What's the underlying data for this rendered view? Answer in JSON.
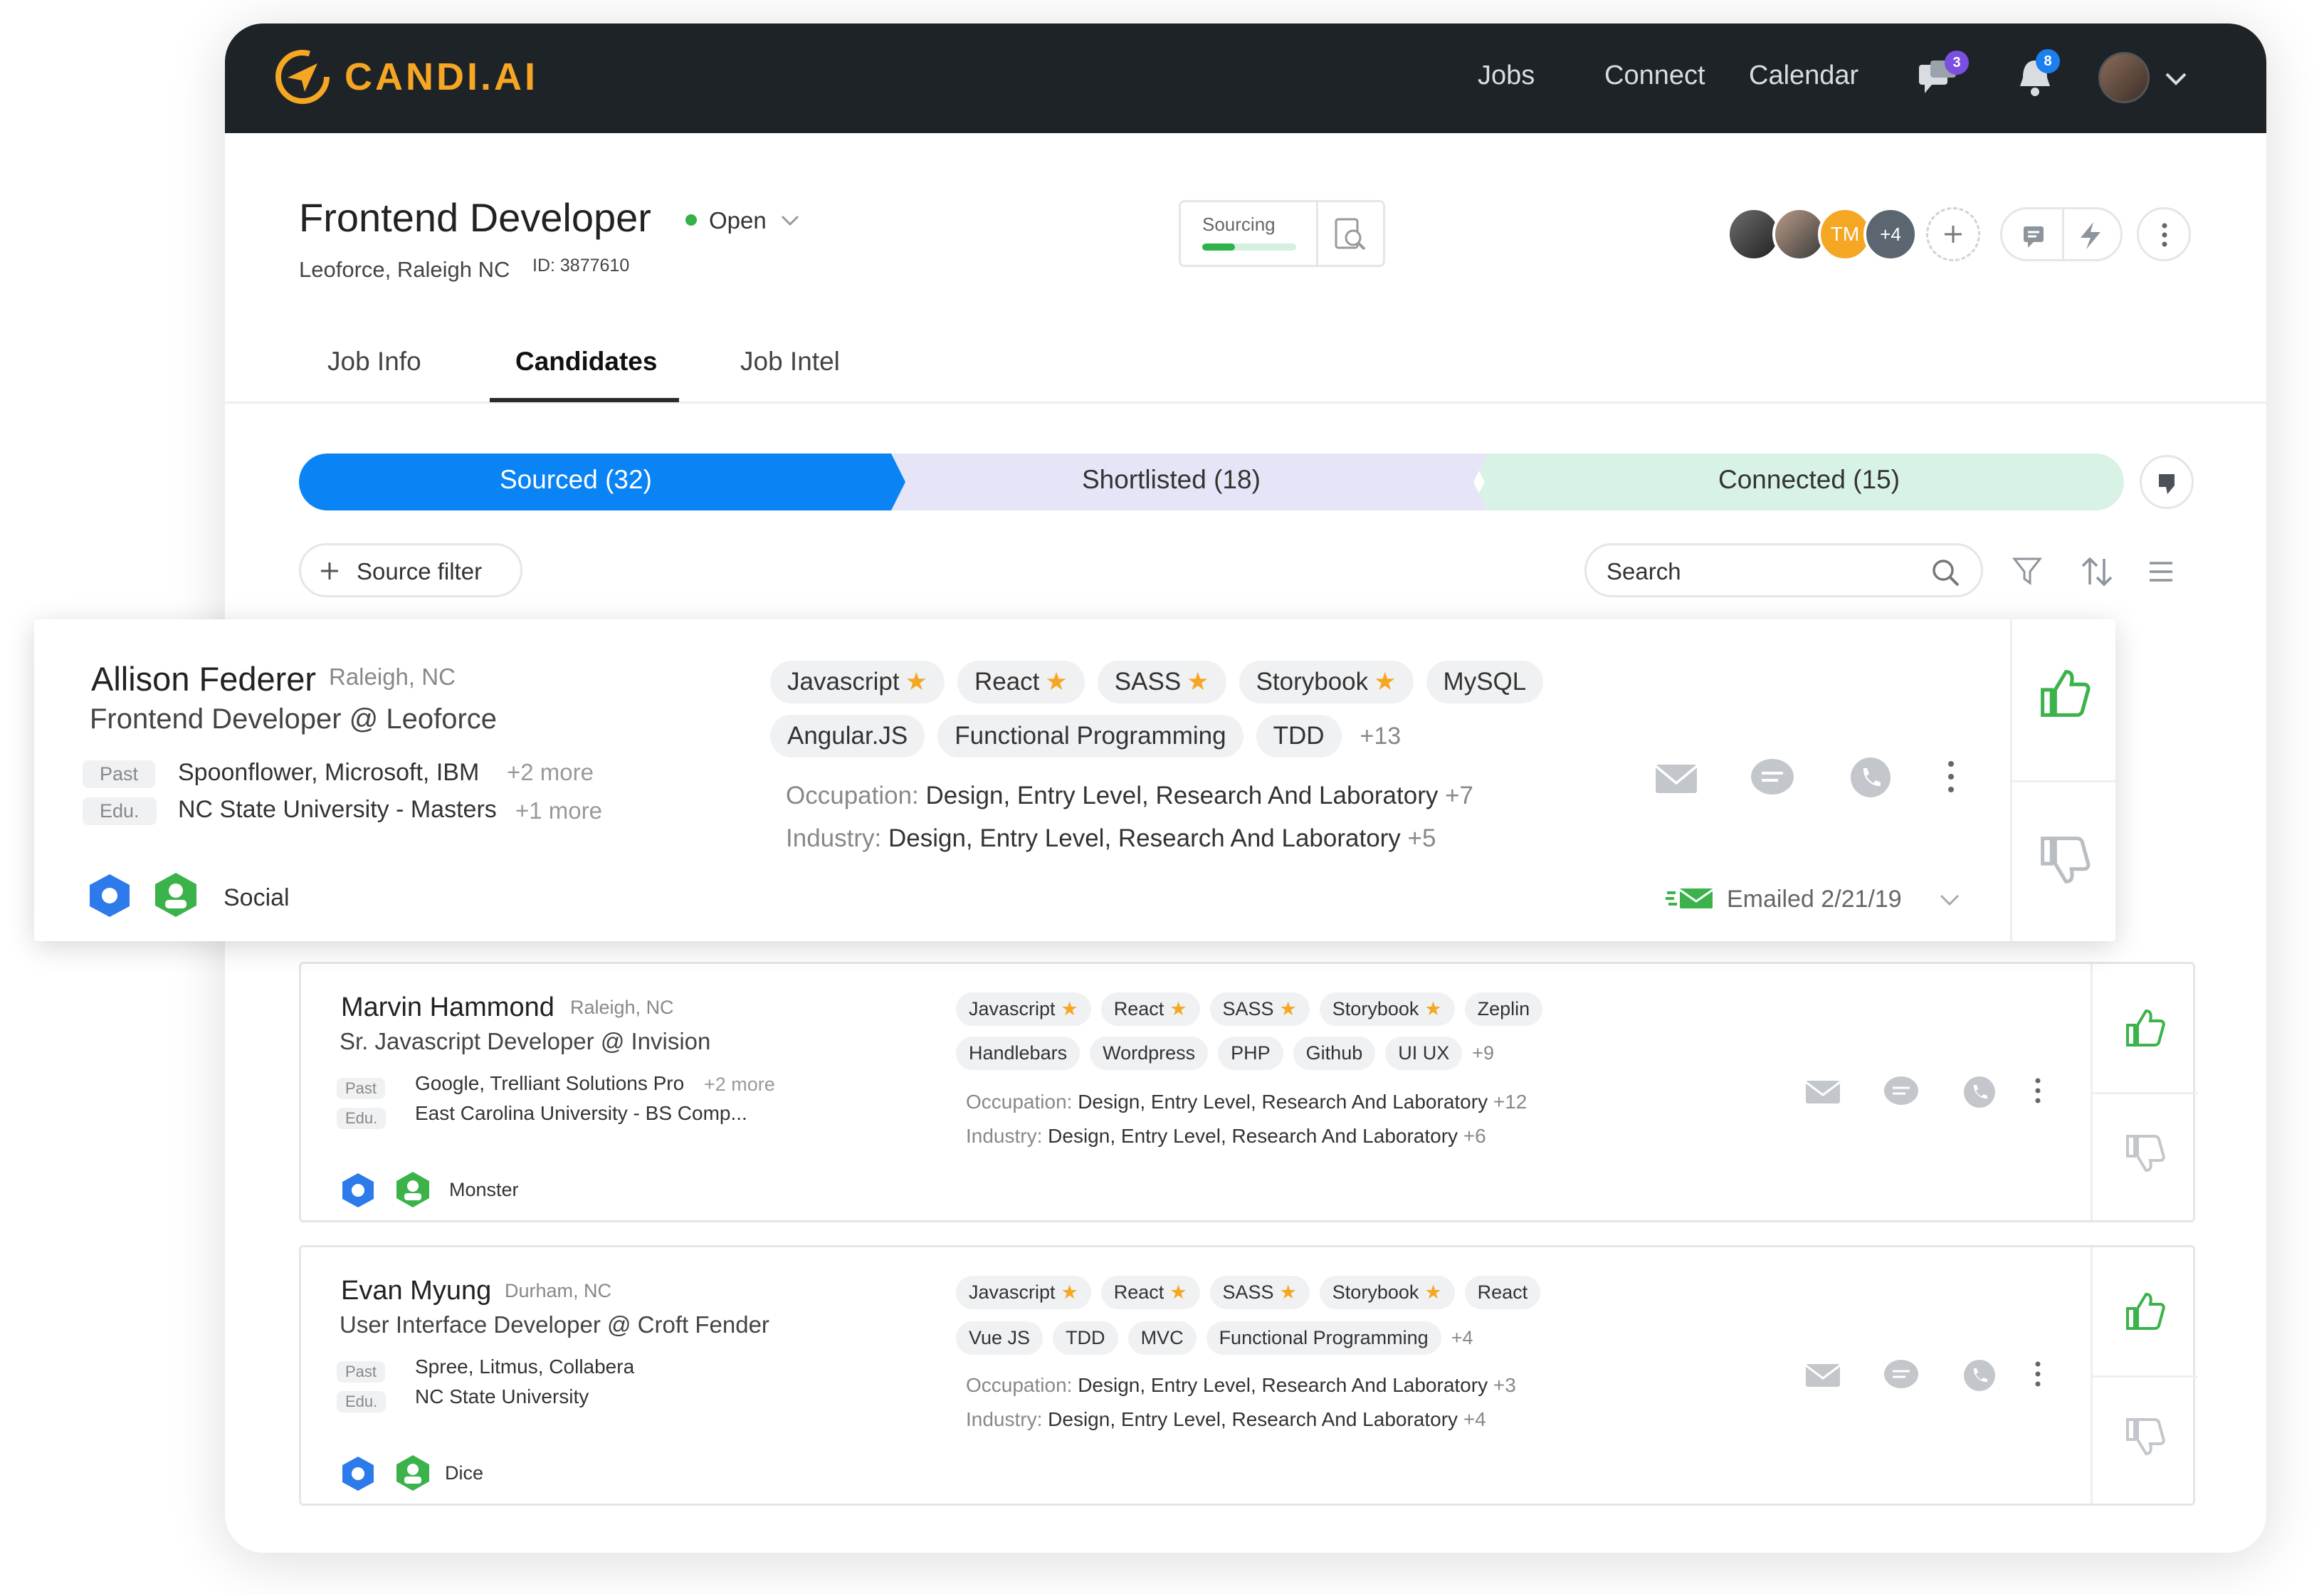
{
  "app": {
    "logo_text": "CANDI.AI",
    "nav": [
      "Jobs",
      "Connect",
      "Calendar"
    ],
    "chat_badge": "3",
    "notif_badge": "8"
  },
  "job": {
    "title": "Frontend Developer",
    "status": "Open",
    "company_location": "Leoforce, Raleigh NC",
    "id_label": "ID: 3877610",
    "sourcing_label": "Sourcing",
    "sourcing_progress": 0.35
  },
  "team": {
    "initials": "TM",
    "more": "+4"
  },
  "tabs": [
    "Job Info",
    "Candidates",
    "Job Intel"
  ],
  "active_tab": "Candidates",
  "pipeline": {
    "sourced": "Sourced (32)",
    "shortlisted": "Shortlisted (18)",
    "connected": "Connected (15)"
  },
  "toolbar": {
    "source_filter": "Source filter",
    "search_placeholder": "Search"
  },
  "candidates": [
    {
      "name": "Allison Federer",
      "location": "Raleigh, NC",
      "headline": "Frontend Developer @ Leoforce",
      "past_label": "Past",
      "past": "Spoonflower, Microsoft, IBM",
      "past_more": "+2 more",
      "edu_label": "Edu.",
      "edu": "NC State University - Masters",
      "edu_more": "+1 more",
      "source": "Social",
      "skills_row1": [
        {
          "name": "Javascript",
          "star": true
        },
        {
          "name": "React",
          "star": true
        },
        {
          "name": "SASS",
          "star": true
        },
        {
          "name": "Storybook",
          "star": true
        },
        {
          "name": "MySQL",
          "star": false
        }
      ],
      "skills_row2": [
        {
          "name": "Angular.JS",
          "star": false
        },
        {
          "name": "Functional Programming",
          "star": false
        },
        {
          "name": "TDD",
          "star": false
        }
      ],
      "skills_more": "+13",
      "occupation_label": "Occupation:",
      "occupation": "Design, Entry Level, Research And Laboratory",
      "occupation_more": "+7",
      "industry_label": "Industry:",
      "industry": "Design, Entry Level, Research And Laboratory",
      "industry_more": "+5",
      "emailed": "Emailed 2/21/19"
    },
    {
      "name": "Marvin Hammond",
      "location": "Raleigh, NC",
      "headline": "Sr. Javascript Developer @ Invision",
      "past_label": "Past",
      "past": "Google, Trelliant Solutions Pro",
      "past_more": "+2 more",
      "edu_label": "Edu.",
      "edu": "East Carolina University - BS Comp...",
      "source": "Monster",
      "skills_row1": [
        {
          "name": "Javascript",
          "star": true
        },
        {
          "name": "React",
          "star": true
        },
        {
          "name": "SASS",
          "star": true
        },
        {
          "name": "Storybook",
          "star": true
        },
        {
          "name": "Zeplin",
          "star": false
        }
      ],
      "skills_row2": [
        {
          "name": "Handlebars",
          "star": false
        },
        {
          "name": "Wordpress",
          "star": false
        },
        {
          "name": "PHP",
          "star": false
        },
        {
          "name": "Github",
          "star": false
        },
        {
          "name": "UI UX",
          "star": false
        }
      ],
      "skills_more": "+9",
      "occupation_label": "Occupation:",
      "occupation": "Design, Entry Level, Research And Laboratory",
      "occupation_more": "+12",
      "industry_label": "Industry:",
      "industry": "Design, Entry Level, Research And Laboratory",
      "industry_more": "+6"
    },
    {
      "name": "Evan Myung",
      "location": "Durham, NC",
      "headline": "User Interface Developer @ Croft Fender",
      "past_label": "Past",
      "past": "Spree, Litmus, Collabera",
      "edu_label": "Edu.",
      "edu": "NC State University",
      "source": "Dice",
      "skills_row1": [
        {
          "name": "Javascript",
          "star": true
        },
        {
          "name": "React",
          "star": true
        },
        {
          "name": "SASS",
          "star": true
        },
        {
          "name": "Storybook",
          "star": true
        },
        {
          "name": "React",
          "star": false
        }
      ],
      "skills_row2": [
        {
          "name": "Vue JS",
          "star": false
        },
        {
          "name": "TDD",
          "star": false
        },
        {
          "name": "MVC",
          "star": false
        },
        {
          "name": "Functional Programming",
          "star": false
        }
      ],
      "skills_more": "+4",
      "occupation_label": "Occupation:",
      "occupation": "Design, Entry Level, Research And Laboratory",
      "occupation_more": "+3",
      "industry_label": "Industry:",
      "industry": "Design, Entry Level, Research And Laboratory",
      "industry_more": "+4"
    }
  ],
  "colors": {
    "brand": "#f5a623",
    "topbar": "#1e2328",
    "sourced": "#0a84f5",
    "shortlisted": "#e6e5f8",
    "connected": "#d9f2e6",
    "like_green": "#3bb24a",
    "icon_grey": "#c3c7cc"
  }
}
